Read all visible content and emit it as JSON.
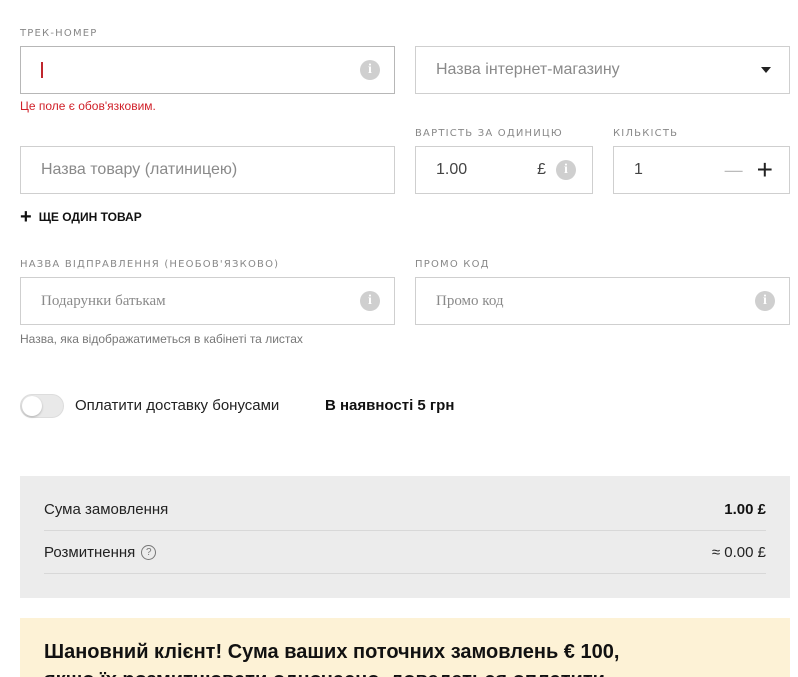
{
  "form": {
    "track": {
      "label": "ТРЕК-НОМЕР",
      "value": "",
      "error": "Це поле є обов'язковим."
    },
    "shop": {
      "placeholder": "Назва інтернет-магазину"
    },
    "product": {
      "placeholder": "Назва товару (латиницею)"
    },
    "price": {
      "label": "ВАРТІСТЬ ЗА ОДИНИЦЮ",
      "value": "1.00",
      "currency": "£"
    },
    "quantity": {
      "label": "КІЛЬКІСТЬ",
      "value": "1",
      "minus": "—",
      "plus": "+"
    },
    "add_item": {
      "icon": "+",
      "label": "ЩЕ ОДИН ТОВАР"
    },
    "shipment_name": {
      "label": "НАЗВА ВІДПРАВЛЕННЯ (НЕОБОВ'ЯЗКОВО)",
      "placeholder": "Подарунки батькам",
      "hint": "Назва, яка відображатиметься в кабінеті та листах"
    },
    "promo": {
      "label": "ПРОМО КОД",
      "placeholder": "Промо код"
    },
    "info_glyph": "i"
  },
  "bonus": {
    "label": "Оплатити доставку бонусами",
    "available": "В наявності 5 грн",
    "enabled": false
  },
  "summary": {
    "order_label": "Сума замовлення",
    "order_value": "1.00 £",
    "customs_label": "Розмитнення",
    "customs_help": "?",
    "customs_value": "≈ 0.00 £"
  },
  "notice": {
    "line1": "Шановний клієнт! Сума ваших поточних замовлень € 100,",
    "line2": "якщо їх розмитнювати одночасно, доведеться оплатити"
  },
  "colors": {
    "error": "#d0212a",
    "summary_bg": "#ececec",
    "notice_bg": "#fdf2d6"
  }
}
